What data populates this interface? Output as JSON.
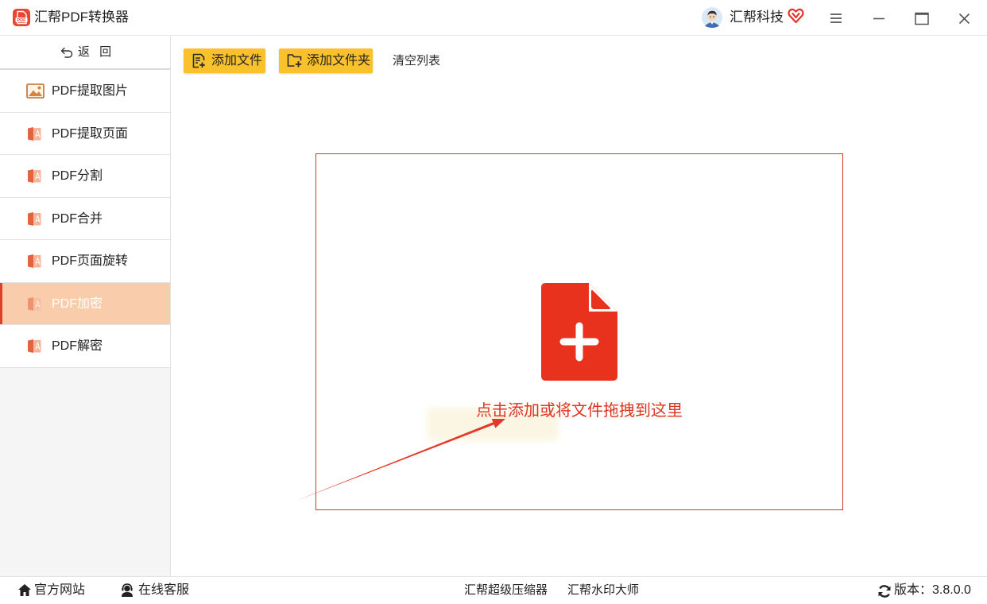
{
  "app": {
    "title": "汇帮PDF转换器",
    "logo_text": "PDF",
    "logo_icon": "pdf-logo-icon"
  },
  "user": {
    "name": "汇帮科技",
    "avatar_icon": "avatar-icon",
    "badge_icon": "vip-heart-icon"
  },
  "window_controls": {
    "menu_icon": "menu-icon",
    "minimize_icon": "minimize-icon",
    "maximize_icon": "maximize-icon",
    "close_icon": "close-icon"
  },
  "sidebar": {
    "back": {
      "label": "返 回",
      "icon": "back-arrow-icon"
    },
    "items": [
      {
        "label": "PDF提取图片",
        "icon": "image-icon",
        "selected": false
      },
      {
        "label": "PDF提取页面",
        "icon": "pdf-icon",
        "selected": false
      },
      {
        "label": "PDF分割",
        "icon": "pdf-icon",
        "selected": false
      },
      {
        "label": "PDF合并",
        "icon": "pdf-icon",
        "selected": false
      },
      {
        "label": "PDF页面旋转",
        "icon": "pdf-icon",
        "selected": false
      },
      {
        "label": "PDF加密",
        "icon": "pdf-icon",
        "selected": true
      },
      {
        "label": "PDF解密",
        "icon": "pdf-icon",
        "selected": false
      }
    ]
  },
  "toolbar": {
    "add_file": {
      "label": "添加文件",
      "icon": "add-file-icon"
    },
    "add_folder": {
      "label": "添加文件夹",
      "icon": "add-folder-icon"
    },
    "clear_list": {
      "label": "清空列表"
    }
  },
  "dropzone": {
    "icon": "add-document-icon",
    "hint": "点击添加或将文件拖拽到这里"
  },
  "footer": {
    "website": {
      "label": "官方网站",
      "icon": "home-icon"
    },
    "support": {
      "label": "在线客服",
      "icon": "headset-icon"
    },
    "links": [
      "汇帮超级压缩器",
      "汇帮水印大师"
    ],
    "version": {
      "label": "版本：3.8.0.0",
      "icon": "refresh-icon"
    }
  },
  "colors": {
    "accent_yellow": "#f9c12c",
    "brand_red": "#e8321e",
    "hint_red": "#dd3420",
    "selected_bg": "#f9cdab",
    "selected_bar": "#e23c2b",
    "sidebar_icon": "#e4643f"
  }
}
